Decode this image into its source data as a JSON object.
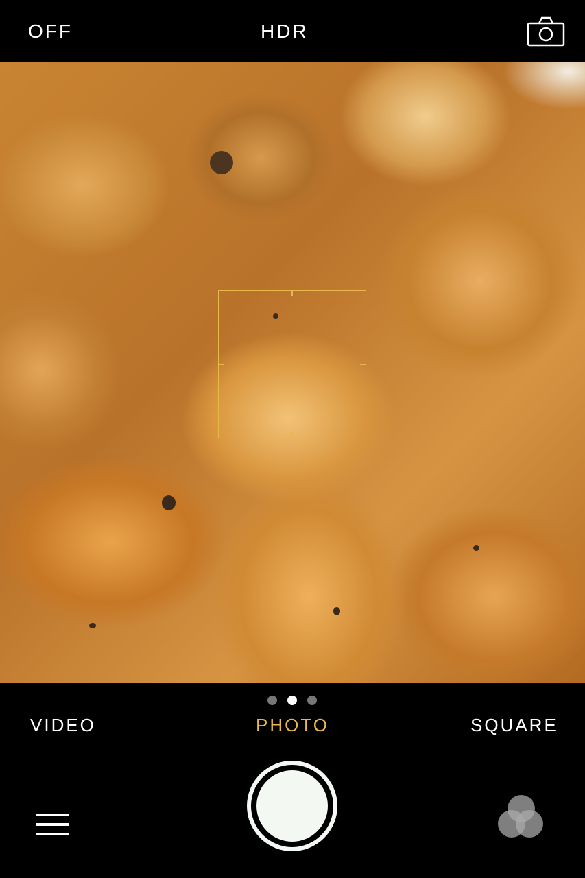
{
  "top_bar": {
    "flash_label": "OFF",
    "hdr_label": "HDR",
    "switch_camera_icon": "camera-switch-icon"
  },
  "viewfinder": {
    "focus_indicator": "focus-square"
  },
  "modes": {
    "items": [
      {
        "label": "VIDEO",
        "active": false
      },
      {
        "label": "PHOTO",
        "active": true
      },
      {
        "label": "SQUARE",
        "active": false
      }
    ],
    "page_dots": 3,
    "active_dot": 2
  },
  "bottom_bar": {
    "menu_icon": "hamburger-menu-icon",
    "shutter_icon": "shutter-button",
    "filters_icon": "filters-icon"
  },
  "colors": {
    "accent": "#e8b84f",
    "background": "#000000"
  }
}
